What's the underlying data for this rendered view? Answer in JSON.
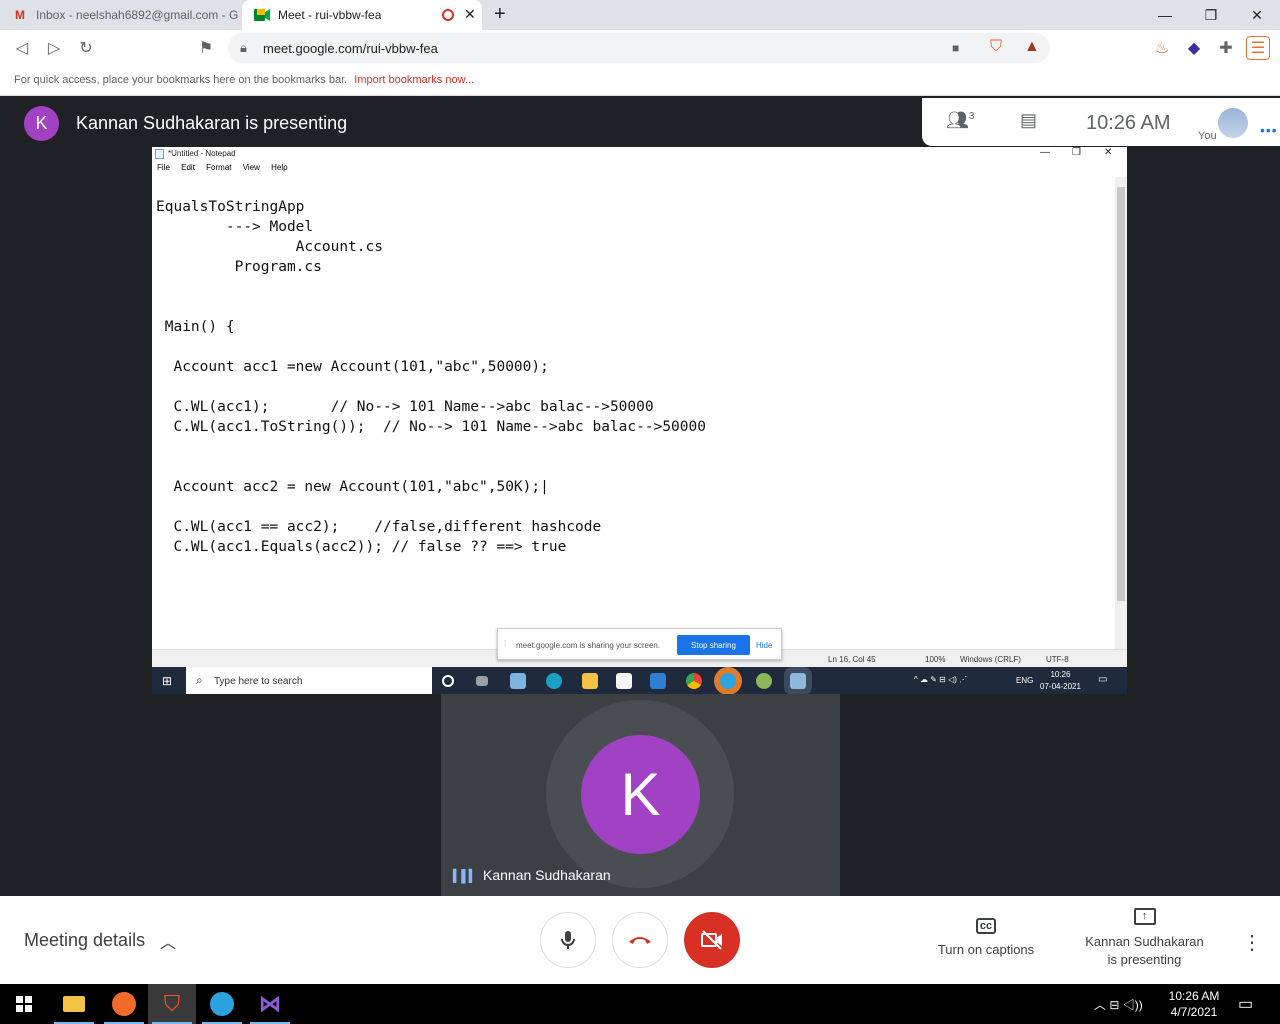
{
  "browser": {
    "tabs": [
      {
        "title": "Inbox - neelshah6892@gmail.com - G",
        "icon": "gmail-icon"
      },
      {
        "title": "Meet - rui-vbbw-fea",
        "icon": "meet-icon"
      }
    ],
    "url": "meet.google.com/rui-vbbw-fea",
    "bookmarks_message": "For quick access, place your bookmarks here on the bookmarks bar.",
    "bookmarks_link": "Import bookmarks now..."
  },
  "meet": {
    "presenter_initial": "K",
    "presenting_title": "Kannan Sudhakaran is presenting",
    "participant_count": "3",
    "clock": "10:26  AM",
    "you_label": "You",
    "participant_name": "Kannan Sudhakaran",
    "participant_initial": "K",
    "meeting_details": "Meeting details",
    "captions_label": "Turn on captions",
    "present_line1": "Kannan Sudhakaran",
    "present_line2": "is presenting",
    "accent_purple": "#a142c4",
    "leave_red": "#d93025"
  },
  "notepad": {
    "title": "*Untitled - Notepad",
    "menu": [
      "File",
      "Edit",
      "Format",
      "View",
      "Help"
    ],
    "lines": [
      "EqualsToStringApp",
      "        ---> Model",
      "                Account.cs",
      "         Program.cs",
      "",
      "",
      " Main() {",
      "",
      "  Account acc1 =new Account(101,\"abc\",50000);",
      "",
      "  C.WL(acc1);       // No--> 101 Name-->abc balac-->50000",
      "  C.WL(acc1.ToString());  // No--> 101 Name-->abc balac-->50000",
      "",
      "",
      "  Account acc2 = new Account(101,\"abc\",50K);|",
      "",
      "  C.WL(acc1 == acc2);    //false,different hashcode",
      "  C.WL(acc1.Equals(acc2)); // false ?? ==> true"
    ],
    "status": {
      "position": "Ln 16, Col 45",
      "zoom": "100%",
      "line_ending": "Windows (CRLF)",
      "encoding": "UTF-8"
    },
    "share_bar": {
      "message": "meet.google.com is sharing your screen.",
      "stop": "Stop sharing",
      "hide": "Hide"
    },
    "inner_taskbar": {
      "search_placeholder": "Type here to search",
      "lang": "ENG",
      "time": "10:26",
      "date": "07-04-2021"
    }
  },
  "taskbar": {
    "time": "10:26 AM",
    "date": "4/7/2021"
  }
}
